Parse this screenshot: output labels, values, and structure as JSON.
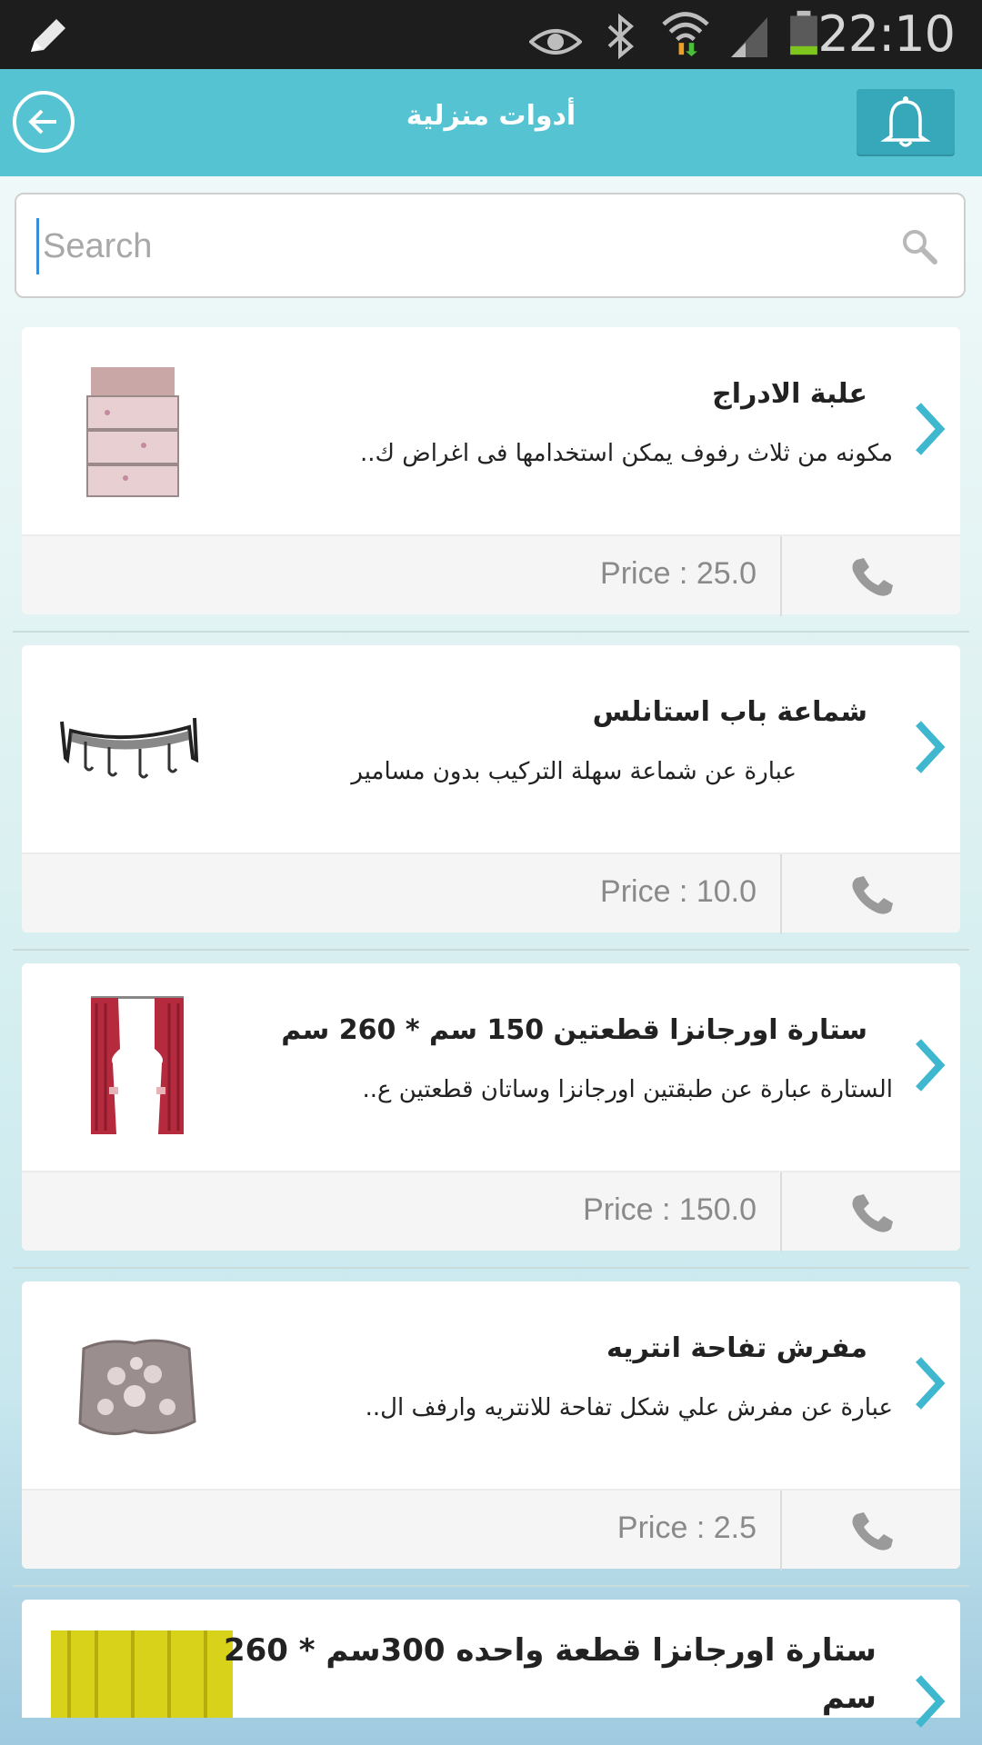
{
  "status_bar": {
    "time": "22:10",
    "icons": [
      "pencil-icon",
      "eye-icon",
      "bluetooth-icon",
      "wifi-icon",
      "signal-icon",
      "battery-icon"
    ]
  },
  "header": {
    "title": "أدوات منزلية",
    "back_icon": "back-arrow-icon",
    "bell_icon": "bell-icon"
  },
  "search": {
    "placeholder": "Search",
    "value": ""
  },
  "products": [
    {
      "title": "علبة الادراج",
      "description": "مكونه من ثلاث رفوف يمكن استخدامها فى اغراض ك..",
      "price": "Price : 25.0"
    },
    {
      "title": "شماعة باب استانلس",
      "description": "عبارة عن شماعة سهلة التركيب بدون مسامير",
      "price": "Price : 10.0"
    },
    {
      "title": "ستارة اورجانزا قطعتين 150 سم * 260 سم",
      "description": "الستارة عبارة عن طبقتين اورجانزا وساتان قطعتين ع..",
      "price": "Price : 150.0"
    },
    {
      "title": "مفرش تفاحة انتريه",
      "description": "عبارة عن مفرش علي شكل تفاحة للانتريه وارفف ال..",
      "price": "Price : 2.5"
    },
    {
      "title": "ستارة اورجانزا قطعة واحده 300سم * 260 سم",
      "description": "",
      "price": ""
    }
  ],
  "colors": {
    "header": "#56c3d2",
    "bell_button": "#37a8ba",
    "chevron": "#3fb7cf",
    "price_text": "#8a8a8a"
  }
}
